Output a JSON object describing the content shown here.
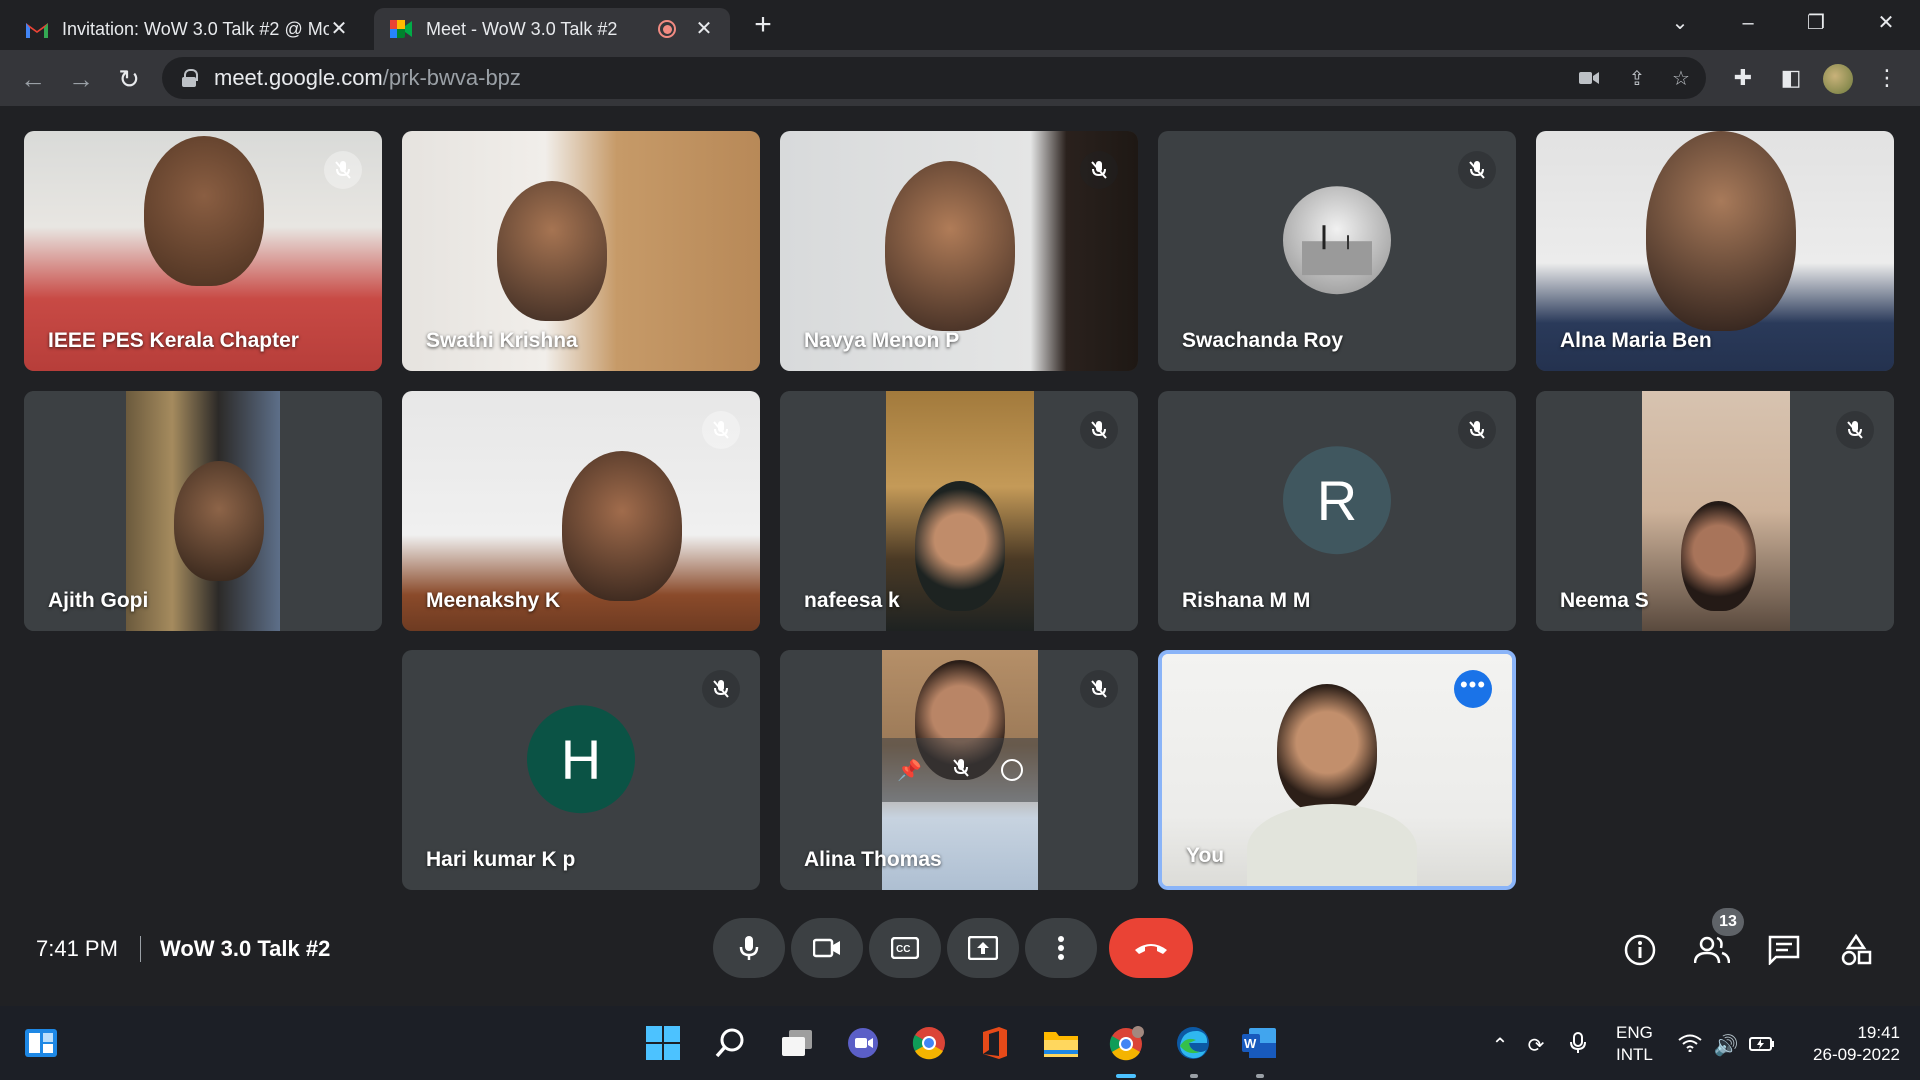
{
  "browser": {
    "tabs": [
      {
        "title": "Invitation: WoW 3.0 Talk #2 @ Mo",
        "active": false
      },
      {
        "title": "Meet - WoW 3.0 Talk #2",
        "active": true
      }
    ],
    "url_host": "meet.google.com",
    "url_path": "/prk-bwva-bpz"
  },
  "meet": {
    "participants": [
      {
        "name": "IEEE PES Kerala Chapter",
        "muted": true
      },
      {
        "name": "Swathi Krishna",
        "muted": false
      },
      {
        "name": "Navya Menon P",
        "muted": true
      },
      {
        "name": "Swachanda Roy",
        "muted": true
      },
      {
        "name": "Alna Maria Ben",
        "muted": false
      },
      {
        "name": "Ajith Gopi",
        "muted": false
      },
      {
        "name": "Meenakshy K",
        "muted": true
      },
      {
        "name": "nafeesa k",
        "muted": true
      },
      {
        "name": "Rishana M M",
        "muted": true,
        "initial": "R"
      },
      {
        "name": "Neema S",
        "muted": true
      },
      {
        "name": "Hari kumar K p",
        "muted": true,
        "initial": "H"
      },
      {
        "name": "Alina Thomas",
        "muted": true
      },
      {
        "name": "You",
        "muted": false
      }
    ],
    "time": "7:41 PM",
    "meeting_title": "WoW 3.0 Talk #2",
    "people_count": "13",
    "colors": {
      "hangup": "#ea4335",
      "accent": "#1a73e8",
      "avatar_h": "#0b5345",
      "avatar_r": "#40575f"
    }
  },
  "taskbar": {
    "lang_line1": "ENG",
    "lang_line2": "INTL",
    "clock_time": "19:41",
    "clock_date": "26-09-2022"
  }
}
